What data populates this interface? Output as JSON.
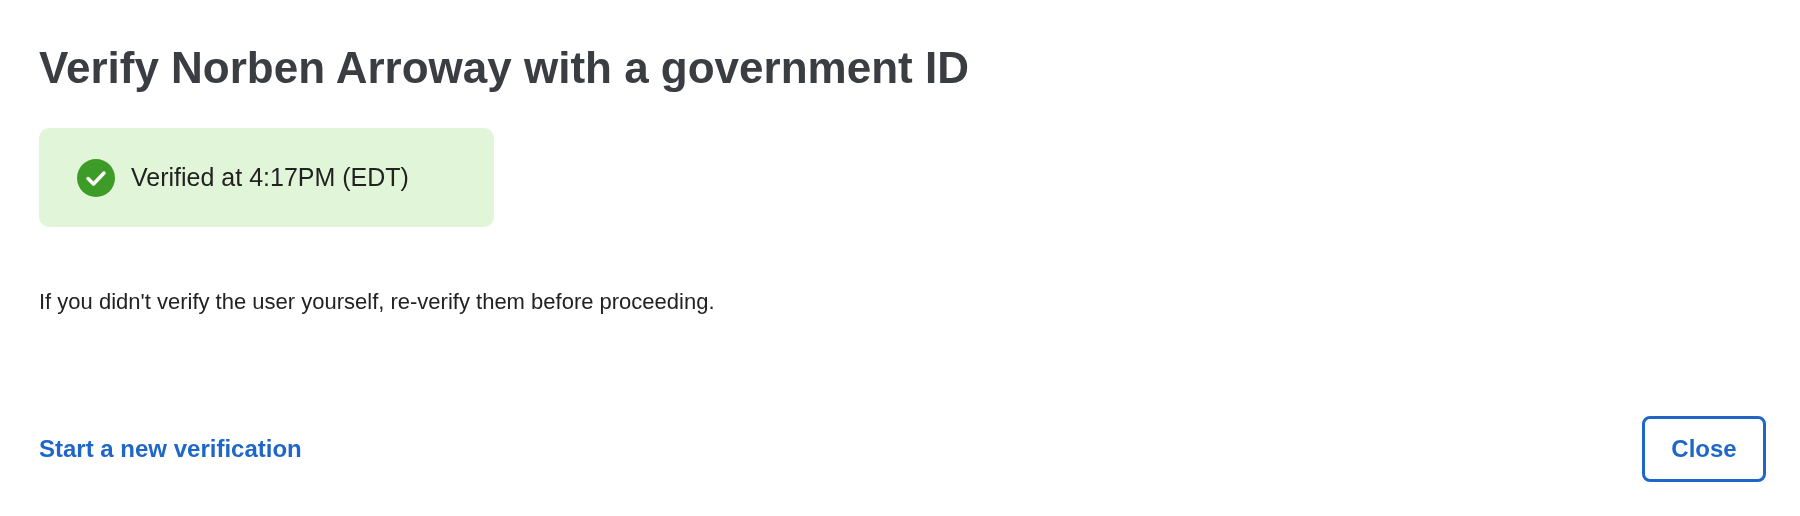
{
  "title": "Verify Norben Arroway with a government ID",
  "status": {
    "kind": "success",
    "text": "Verified at 4:17PM (EDT)"
  },
  "message": "If you didn't verify the user yourself, re-verify them before proceeding.",
  "link": "Start a new verification",
  "buttons": [
    "Close"
  ]
}
